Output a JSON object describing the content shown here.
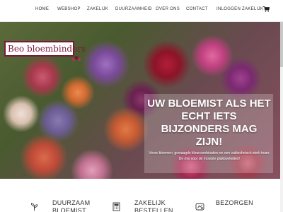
{
  "nav": {
    "items": [
      {
        "label": "HOME"
      },
      {
        "label": "WEBSHOP"
      },
      {
        "label": "ZAKELIJK"
      },
      {
        "label": "DUURZAAMHEID"
      },
      {
        "label": "OVER ONS"
      },
      {
        "label": "CONTACT"
      },
      {
        "label": "INLOGGEN ZAKELIJK"
      }
    ],
    "cart_icon": "shopping-cart-icon"
  },
  "logo": {
    "text": "Beo bloembinders",
    "icon": "flower-icon"
  },
  "hero": {
    "heading": "UW BLOEMIST ALS HET ECHT IETS BIJZONDERS MAG ZIJN!",
    "subtext": "Verse bloemen, gewaagde kleurcombinaties en een vaktechnisch sterk team. De mix voor de mooiste plukboeketten!"
  },
  "features": [
    {
      "label": "DUURZAAM BLOEMIST",
      "icon": "leaf-icon"
    },
    {
      "label": "ZAKELIJK BESTELLEN",
      "icon": "calculator-icon"
    },
    {
      "label": "BEZORGEN",
      "icon": "delivery-icon"
    }
  ],
  "colors": {
    "brand": "#7a1a3a",
    "nav_text": "#333333",
    "hero_text": "#ffffff"
  }
}
